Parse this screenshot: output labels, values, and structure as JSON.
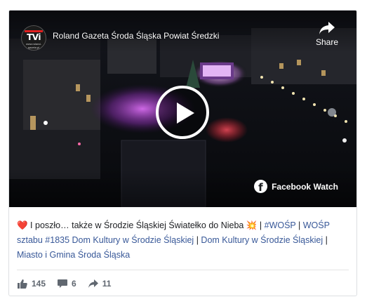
{
  "video": {
    "title": "Roland Gazeta Środa Śląska Powiat Średzki",
    "channel_logo": "TVi",
    "channel_logo_sub": "www.roland-gazeta.pl",
    "share_label": "Share",
    "watch_label": "Facebook Watch",
    "icons": [
      "share-icon",
      "play-icon",
      "facebook-icon"
    ]
  },
  "post": {
    "heart_emoji": "❤️",
    "text_main": " I poszło… także w Środzie Śląskiej Światełko do Nieba ",
    "spark_emoji": "💥",
    "sep1": " | ",
    "link1": "#WOŚP",
    "sep2": " | ",
    "link2": "WOŚP sztabu #1835 Dom Kultury w Środzie Śląskiej",
    "sep3": " | ",
    "link3": "Dom Kultury w Środzie Śląskiej",
    "sep4": " | ",
    "link4": "Miasto i Gmina Środa Śląska"
  },
  "stats": {
    "likes": "145",
    "comments": "6",
    "shares": "11"
  },
  "colors": {
    "link": "#385898",
    "meta": "#606770",
    "accent_stage": "#c24fd6"
  }
}
